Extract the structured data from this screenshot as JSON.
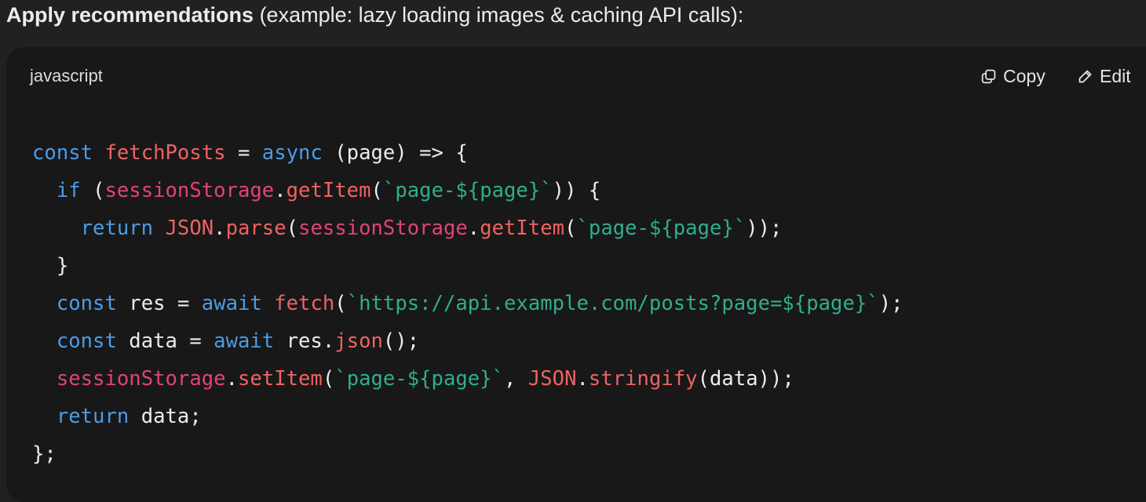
{
  "heading": {
    "strong": "Apply recommendations",
    "rest": " (example: lazy loading images & caching API calls):"
  },
  "code_block": {
    "language": "javascript",
    "copy_label": "Copy",
    "edit_label": "Edit",
    "icons": {
      "copy": "copy-icon",
      "edit": "pencil-icon"
    },
    "colors": {
      "background": "#181818",
      "keyword": "#4d9be6",
      "function": "#ef6262",
      "builtin": "#e0437a",
      "string": "#2fae8e",
      "plain": "#ececec"
    },
    "lines": [
      [
        {
          "t": "const",
          "k": "keyword"
        },
        {
          "t": " ",
          "k": "plain"
        },
        {
          "t": "fetchPosts",
          "k": "func"
        },
        {
          "t": " = ",
          "k": "plain"
        },
        {
          "t": "async",
          "k": "keyword"
        },
        {
          "t": " (page) => {",
          "k": "plain"
        }
      ],
      [
        {
          "t": "  ",
          "k": "plain"
        },
        {
          "t": "if",
          "k": "keyword"
        },
        {
          "t": " (",
          "k": "plain"
        },
        {
          "t": "sessionStorage",
          "k": "builtin"
        },
        {
          "t": ".",
          "k": "plain"
        },
        {
          "t": "getItem",
          "k": "func"
        },
        {
          "t": "(",
          "k": "plain"
        },
        {
          "t": "`page-${page}`",
          "k": "string"
        },
        {
          "t": ")) {",
          "k": "plain"
        }
      ],
      [
        {
          "t": "    ",
          "k": "plain"
        },
        {
          "t": "return",
          "k": "keyword"
        },
        {
          "t": " ",
          "k": "plain"
        },
        {
          "t": "JSON",
          "k": "func"
        },
        {
          "t": ".",
          "k": "plain"
        },
        {
          "t": "parse",
          "k": "func"
        },
        {
          "t": "(",
          "k": "plain"
        },
        {
          "t": "sessionStorage",
          "k": "builtin"
        },
        {
          "t": ".",
          "k": "plain"
        },
        {
          "t": "getItem",
          "k": "func"
        },
        {
          "t": "(",
          "k": "plain"
        },
        {
          "t": "`page-${page}`",
          "k": "string"
        },
        {
          "t": "));",
          "k": "plain"
        }
      ],
      [
        {
          "t": "  }",
          "k": "plain"
        }
      ],
      [
        {
          "t": "  ",
          "k": "plain"
        },
        {
          "t": "const",
          "k": "keyword"
        },
        {
          "t": " res = ",
          "k": "plain"
        },
        {
          "t": "await",
          "k": "keyword"
        },
        {
          "t": " ",
          "k": "plain"
        },
        {
          "t": "fetch",
          "k": "func"
        },
        {
          "t": "(",
          "k": "plain"
        },
        {
          "t": "`https://api.example.com/posts?page=${page}`",
          "k": "string"
        },
        {
          "t": ");",
          "k": "plain"
        }
      ],
      [
        {
          "t": "  ",
          "k": "plain"
        },
        {
          "t": "const",
          "k": "keyword"
        },
        {
          "t": " data = ",
          "k": "plain"
        },
        {
          "t": "await",
          "k": "keyword"
        },
        {
          "t": " res.",
          "k": "plain"
        },
        {
          "t": "json",
          "k": "func"
        },
        {
          "t": "();",
          "k": "plain"
        }
      ],
      [
        {
          "t": "  ",
          "k": "plain"
        },
        {
          "t": "sessionStorage",
          "k": "builtin"
        },
        {
          "t": ".",
          "k": "plain"
        },
        {
          "t": "setItem",
          "k": "func"
        },
        {
          "t": "(",
          "k": "plain"
        },
        {
          "t": "`page-${page}`",
          "k": "string"
        },
        {
          "t": ", ",
          "k": "plain"
        },
        {
          "t": "JSON",
          "k": "func"
        },
        {
          "t": ".",
          "k": "plain"
        },
        {
          "t": "stringify",
          "k": "func"
        },
        {
          "t": "(data));",
          "k": "plain"
        }
      ],
      [
        {
          "t": "  ",
          "k": "plain"
        },
        {
          "t": "return",
          "k": "keyword"
        },
        {
          "t": " data;",
          "k": "plain"
        }
      ],
      [
        {
          "t": "};",
          "k": "plain"
        }
      ]
    ]
  }
}
